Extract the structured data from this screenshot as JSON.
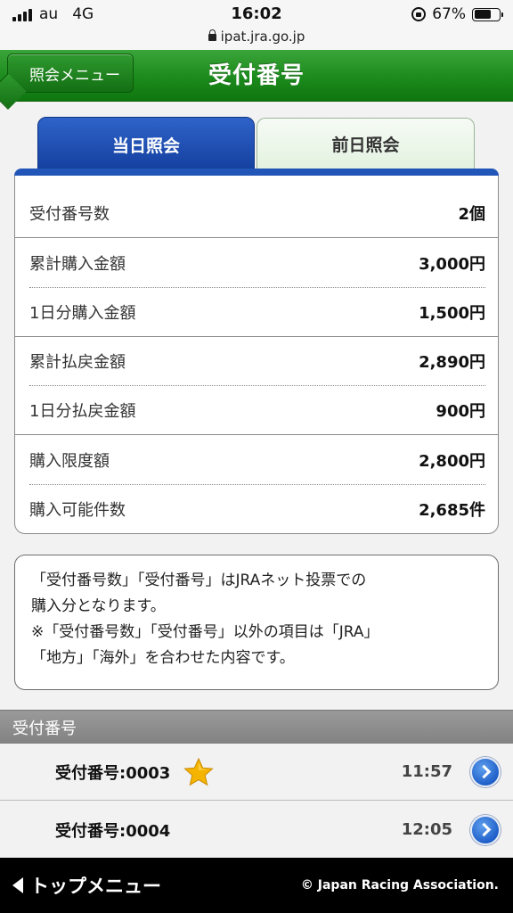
{
  "status": {
    "carrier": "au",
    "network": "4G",
    "time": "16:02",
    "battery": "67%",
    "battery_level": 0.67
  },
  "url": "ipat.jra.go.jp",
  "header": {
    "back_label": "照会メニュー",
    "title": "受付番号"
  },
  "tabs": [
    {
      "label": "当日照会",
      "active": true
    },
    {
      "label": "前日照会",
      "active": false
    }
  ],
  "summary": [
    {
      "label": "受付番号数",
      "value": "2個"
    },
    {
      "label": "累計購入金額",
      "value": "3,000円"
    },
    {
      "label": "1日分購入金額",
      "value": "1,500円"
    },
    {
      "label": "累計払戻金額",
      "value": "2,890円"
    },
    {
      "label": "1日分払戻金額",
      "value": "900円"
    },
    {
      "label": "購入限度額",
      "value": "2,800円"
    },
    {
      "label": "購入可能件数",
      "value": "2,685件"
    }
  ],
  "notice": {
    "line1": "「受付番号数」「受付番号」はJRAネット投票での",
    "line2": "購入分となります。",
    "line3": "※「受付番号数」「受付番号」以外の項目は「JRA」",
    "line4": "「地方」「海外」を合わせた内容です。"
  },
  "section_title": "受付番号",
  "receipts": [
    {
      "label": "受付番号:0003",
      "time": "11:57",
      "starred": true
    },
    {
      "label": "受付番号:0004",
      "time": "12:05",
      "starred": false
    }
  ],
  "footer": {
    "top_menu": "トップメニュー",
    "copyright": "© Japan Racing Association."
  },
  "colors": {
    "header_green": "#1c8a1c",
    "tab_blue": "#2155b7",
    "star": "#f5b400"
  },
  "icons": [
    "signal-bars-icon",
    "rotation-lock-icon",
    "battery-icon",
    "lock-icon",
    "star-icon",
    "chevron-right-icon",
    "triangle-left-icon"
  ]
}
